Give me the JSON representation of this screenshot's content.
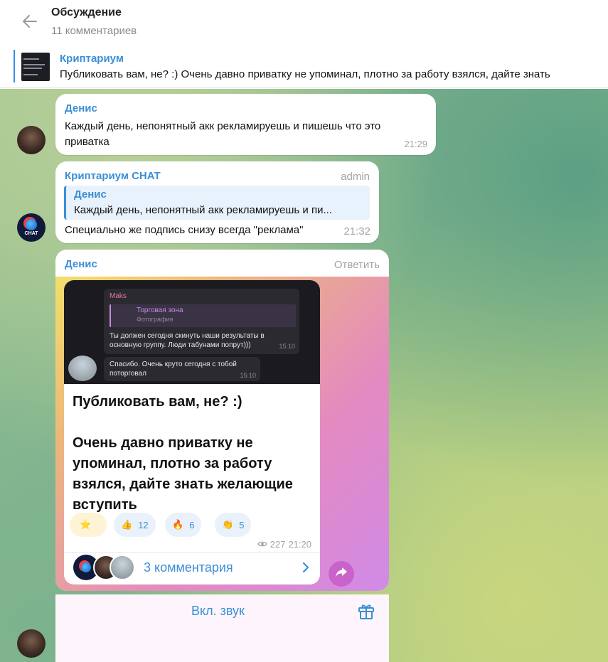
{
  "header": {
    "title": "Обсуждение",
    "subtitle": "11 комментариев"
  },
  "pinned": {
    "name": "Криптариум",
    "text": "Публиковать вам, не? :)  Очень давно приватку не упоминал, плотно за работу взялся, дайте знать"
  },
  "messages": [
    {
      "author": "Денис",
      "text": "Каждый день, непонятный акк рекламируешь и пишешь что это приватка",
      "time": "21:29"
    },
    {
      "author": "Криптариум CHAT",
      "badge": "admin",
      "reply_author": "Денис",
      "reply_text": "Каждый день, непонятный акк рекламируешь и пи...",
      "text": "Специально же подпись снизу всегда \"реклама\"",
      "time": "21:32"
    }
  ],
  "forward": {
    "author": "Денис",
    "reply_label": "Ответить",
    "preview": {
      "sender": "Maks",
      "reply_title": "Торговая зона",
      "reply_sub": "Фотография",
      "msg1": "Ты должен сегодня скинуть наши результаты в основную группу. Люди табунами попрут)))",
      "time1": "15:10",
      "msg2": "Спасибо. Очень круто сегодня с тобой поторговал",
      "time2": "15:10"
    },
    "post_line1": "Публиковать вам, не? :)",
    "post_line2": "Очень давно приватку не упоминал, плотно за работу взялся, дайте знать желающие вступить",
    "reactions": [
      {
        "emoji": "⭐",
        "count": ""
      },
      {
        "emoji": "👍",
        "count": "12"
      },
      {
        "emoji": "🔥",
        "count": "6"
      },
      {
        "emoji": "👏",
        "count": "5"
      }
    ],
    "views": "227",
    "post_time": "21:20",
    "comments_label": "3 комментария",
    "avatar_chat_label": "CHAT"
  },
  "bottom": {
    "sound_label": "Вкл. звук"
  },
  "colors": {
    "accent": "#3a8fd6",
    "forward_gradient": [
      "#f2df6b",
      "#e48ac0",
      "#d08ae8"
    ]
  }
}
